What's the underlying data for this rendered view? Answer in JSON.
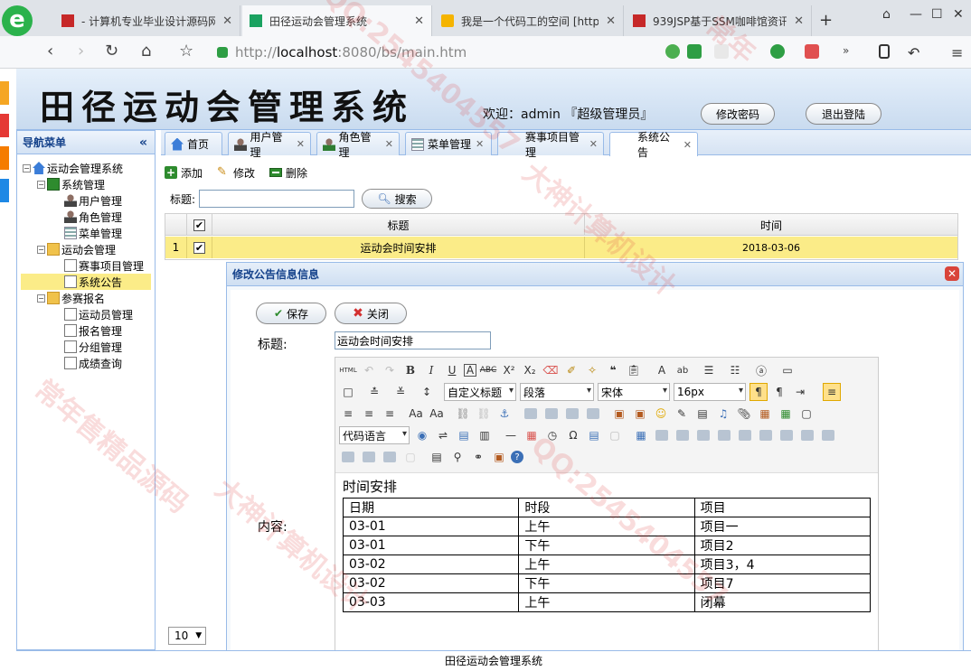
{
  "browser": {
    "tabs": [
      {
        "title": "- 计算机专业毕业设计源码网"
      },
      {
        "title": "田径运动会管理系统"
      },
      {
        "title": "我是一个代码工的空间 [http"
      },
      {
        "title": "939JSP基于SSM咖啡馆资讯"
      }
    ],
    "url_prefix": "http://",
    "url_host": "localhost",
    "url_rest": ":8080/bs/main.htm"
  },
  "header": {
    "title": "田径运动会管理系统",
    "welcome": "欢迎：admin 『超级管理员』",
    "change_pwd": "修改密码",
    "logout": "退出登陆"
  },
  "nav": {
    "title": "导航菜单",
    "root": "运动会管理系统",
    "groups": [
      {
        "label": "系统管理",
        "items": [
          "用户管理",
          "角色管理",
          "菜单管理"
        ]
      },
      {
        "label": "运动会管理",
        "items": [
          "赛事项目管理",
          "系统公告"
        ]
      },
      {
        "label": "参赛报名",
        "items": [
          "运动员管理",
          "报名管理",
          "分组管理",
          "成绩查询"
        ]
      }
    ]
  },
  "tabs": [
    "首页",
    "用户管理",
    "角色管理",
    "菜单管理",
    "赛事项目管理",
    "系统公告"
  ],
  "toolbar": {
    "add": "添加",
    "edit": "修改",
    "delete": "删除"
  },
  "search": {
    "label": "标题:",
    "button": "搜索"
  },
  "grid": {
    "columns": [
      "标题",
      "时间"
    ],
    "rows": [
      {
        "num": "1",
        "title": "运动会时间安排",
        "time": "2018-03-06"
      }
    ]
  },
  "dialog": {
    "title": "修改公告信息信息",
    "save": "保存",
    "close": "关闭",
    "title_label": "标题:",
    "title_value": "运动会时间安排",
    "content_label": "内容:"
  },
  "editor": {
    "custom_heading": "自定义标题",
    "paragraph": "段落",
    "font": "宋体",
    "size": "16px",
    "code_lang": "代码语言"
  },
  "content": {
    "heading": "时间安排",
    "table": [
      [
        "日期",
        "时段",
        "项目"
      ],
      [
        "03-01",
        "上午",
        "项目一"
      ],
      [
        "03-01",
        "下午",
        "项目2"
      ],
      [
        "03-02",
        "上午",
        "项目3，4"
      ],
      [
        "03-02",
        "下午",
        "项目7"
      ],
      [
        "03-03",
        "上午",
        "闭幕"
      ]
    ]
  },
  "pager": {
    "page_size": "10"
  },
  "footer": "田径运动会管理系统",
  "watermark": {
    "a": "QQ:2545404557",
    "b": "常年",
    "c": "大神计算机设计",
    "d": "常年售精品源码"
  }
}
